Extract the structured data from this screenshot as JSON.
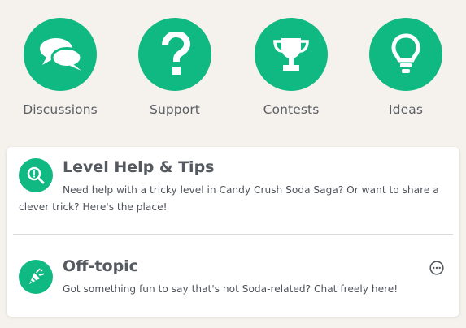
{
  "nav": {
    "discussions": "Discussions",
    "support": "Support",
    "contests": "Contests",
    "ideas": "Ideas"
  },
  "boards": [
    {
      "title": "Level Help & Tips",
      "description": "Need help with a tricky level in Candy Crush Soda Saga? Or want to share a clever trick? Here's the place!",
      "icon": "magnifier-icon"
    },
    {
      "title": "Off-topic",
      "description": "Got something fun to say that's not Soda-related? Chat freely here!",
      "icon": "party-popper-icon"
    }
  ],
  "colors": {
    "accent": "#10b982",
    "background": "#f5f1ec",
    "card": "#ffffff",
    "text": "#555a61"
  }
}
